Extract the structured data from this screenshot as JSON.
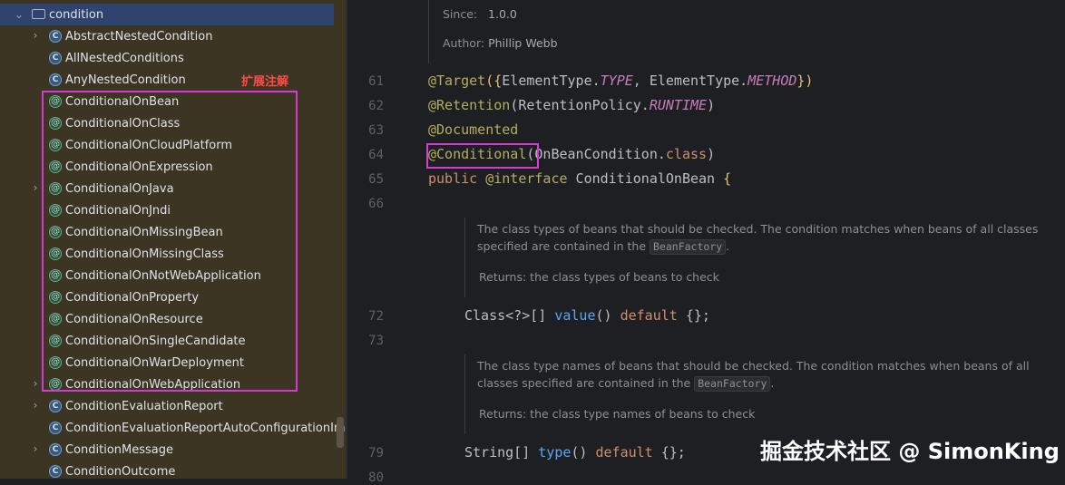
{
  "tree": {
    "folder": "condition",
    "items": [
      {
        "label": "AbstractNestedCondition",
        "icon": "class",
        "expandable": true
      },
      {
        "label": "AllNestedConditions",
        "icon": "class",
        "expandable": false
      },
      {
        "label": "AnyNestedCondition",
        "icon": "class",
        "expandable": false
      },
      {
        "label": "ConditionalOnBean",
        "icon": "annotation",
        "expandable": false
      },
      {
        "label": "ConditionalOnClass",
        "icon": "annotation",
        "expandable": false
      },
      {
        "label": "ConditionalOnCloudPlatform",
        "icon": "annotation",
        "expandable": false
      },
      {
        "label": "ConditionalOnExpression",
        "icon": "annotation",
        "expandable": false
      },
      {
        "label": "ConditionalOnJava",
        "icon": "annotation",
        "expandable": true
      },
      {
        "label": "ConditionalOnJndi",
        "icon": "annotation",
        "expandable": false
      },
      {
        "label": "ConditionalOnMissingBean",
        "icon": "annotation",
        "expandable": false
      },
      {
        "label": "ConditionalOnMissingClass",
        "icon": "annotation",
        "expandable": false
      },
      {
        "label": "ConditionalOnNotWebApplication",
        "icon": "annotation",
        "expandable": false
      },
      {
        "label": "ConditionalOnProperty",
        "icon": "annotation",
        "expandable": false
      },
      {
        "label": "ConditionalOnResource",
        "icon": "annotation",
        "expandable": false
      },
      {
        "label": "ConditionalOnSingleCandidate",
        "icon": "annotation",
        "expandable": false
      },
      {
        "label": "ConditionalOnWarDeployment",
        "icon": "annotation",
        "expandable": false
      },
      {
        "label": "ConditionalOnWebApplication",
        "icon": "annotation",
        "expandable": true
      },
      {
        "label": "ConditionEvaluationReport",
        "icon": "class",
        "expandable": true
      },
      {
        "label": "ConditionEvaluationReportAutoConfigurationImpo",
        "icon": "class",
        "expandable": false
      },
      {
        "label": "ConditionMessage",
        "icon": "class",
        "expandable": true
      },
      {
        "label": "ConditionOutcome",
        "icon": "class",
        "expandable": false
      }
    ],
    "annotation_note": "扩展注解"
  },
  "editor": {
    "doc_top": {
      "since_label": "Since:",
      "since_value": "1.0.0",
      "author_label": "Author:",
      "author_value": "Phillip Webb"
    },
    "lines": {
      "l61": "61",
      "l62": "62",
      "l63": "63",
      "l64": "64",
      "l65": "65",
      "l66": "66",
      "l72": "72",
      "l73": "73",
      "l79": "79",
      "l80": "80"
    },
    "code": {
      "target_ann": "@Target",
      "target_open": "({",
      "target_cls1": "ElementType.",
      "target_en1": "TYPE",
      "target_sep": ", ",
      "target_cls2": "ElementType.",
      "target_en2": "METHOD",
      "target_close": "})",
      "retention_ann": "@Retention",
      "retention_open": "(RetentionPolicy.",
      "retention_en": "RUNTIME",
      "retention_close": ")",
      "documented_ann": "@Documented",
      "conditional_ann": "@Conditional",
      "conditional_rest": "(OnBeanCondition.",
      "conditional_kw": "class",
      "conditional_close": ")",
      "decl_kw": "public ",
      "decl_ann": "@interface",
      "decl_name": " ConditionalOnBean ",
      "decl_brace": "{",
      "value_type": "Class<?>[] ",
      "value_fn": "value",
      "value_paren": "() ",
      "value_kw": "default",
      "value_rest": " {};",
      "type_type": "String[] ",
      "type_fn": "type",
      "type_paren": "() ",
      "type_kw": "default",
      "type_rest": " {};"
    },
    "doc1": {
      "line1": "The class types of beans that should be checked. The condition matches when beans of all classes",
      "line2_pre": "specified are contained in the ",
      "chip": "BeanFactory",
      "line2_post": ".",
      "returns": "Returns: the class types of beans to check"
    },
    "doc2": {
      "line1": "The class type names of beans that should be checked. The condition matches when beans of all",
      "line2_pre": "classes specified are contained in the ",
      "chip": "BeanFactory",
      "line2_post": ".",
      "returns": "Returns: the class type names of beans to check"
    }
  },
  "watermark": "掘金技术社区 @ SimonKing"
}
